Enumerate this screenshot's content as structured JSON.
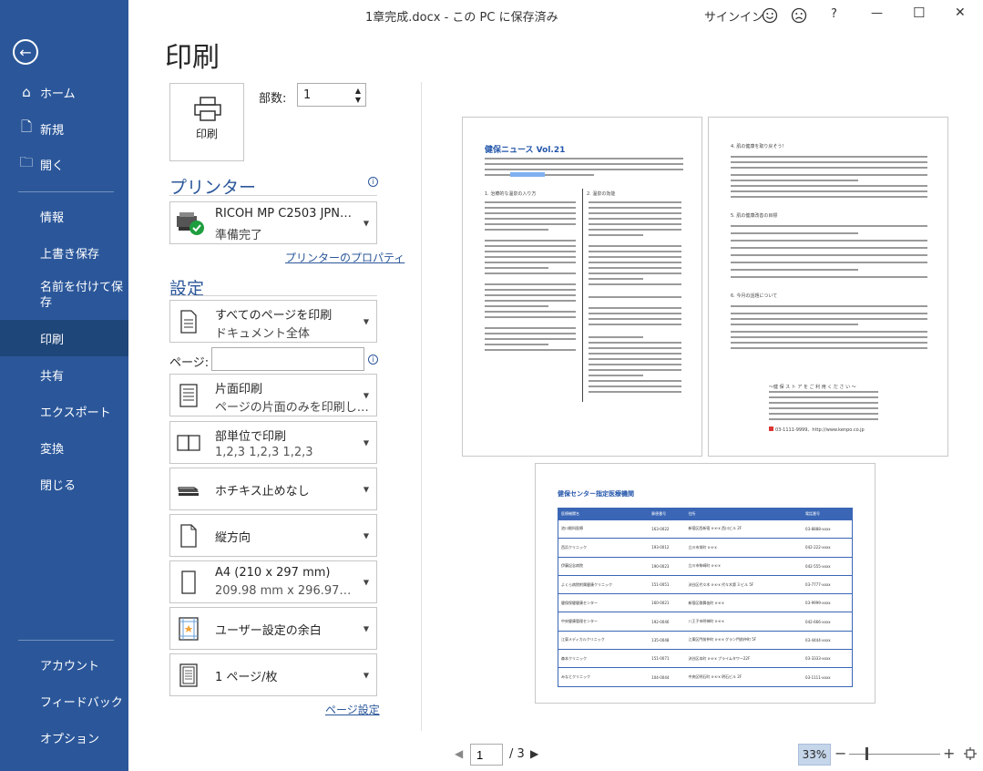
{
  "titlebar": {
    "doc_title": "1章完成.docx - この PC に保存済み",
    "signin": "サインイン",
    "help": "?",
    "minimize": "—",
    "maximize": "☐",
    "close": "✕"
  },
  "sidebar": {
    "back_icon": "←",
    "items": [
      {
        "label": "ホーム",
        "icon": "⌂"
      },
      {
        "label": "新規",
        "icon": "🗋"
      },
      {
        "label": "開く",
        "icon": "🗀"
      },
      {
        "label": "情報"
      },
      {
        "label": "上書き保存"
      },
      {
        "label": "名前を付けて保\n存"
      },
      {
        "label": "印刷"
      },
      {
        "label": "共有"
      },
      {
        "label": "エクスポート"
      },
      {
        "label": "変換"
      },
      {
        "label": "閉じる"
      },
      {
        "label": "アカウント"
      },
      {
        "label": "フィードバック"
      },
      {
        "label": "オプション"
      }
    ],
    "accent": "#2b579a",
    "active_bg": "#1f4679"
  },
  "print": {
    "title": "印刷",
    "button_label": "印刷",
    "copies_label": "部数:",
    "copies_value": "1",
    "printer_heading": "プリンター",
    "printer_name": "RICOH MP C2503 JPN…",
    "printer_status": "準備完了",
    "printer_properties": "プリンターのプロパティ",
    "settings_heading": "設定",
    "pages_label": "ページ:",
    "pages_value": "",
    "page_setup": "ページ設定",
    "settings": [
      {
        "l1": "すべてのページを印刷",
        "l2": "ドキュメント全体"
      },
      {
        "l1": "片面印刷",
        "l2": "ページの片面のみを印刷し…"
      },
      {
        "l1": "部単位で印刷",
        "l2": "1,2,3    1,2,3    1,2,3"
      },
      {
        "l1": "ホチキス止めなし",
        "l2": ""
      },
      {
        "l1": "縦方向",
        "l2": ""
      },
      {
        "l1": "A4 (210 x 297 mm)",
        "l2": "209.98 mm x 296.97…"
      },
      {
        "l1": "ユーザー設定の余白",
        "l2": ""
      },
      {
        "l1": "1 ページ/枚",
        "l2": ""
      }
    ]
  },
  "preview": {
    "page1": {
      "title": "健保ニュース  Vol.21",
      "col1_head": "1. 治療的な温泉の入り方",
      "col2_head": "2. 温泉の効能"
    },
    "page2": {
      "head1": "4. 肌の健康を取り戻そう！",
      "head2": "5. 肌の健康改善の目標",
      "head3": "6. 今月の話題について",
      "closing": "～健 保 ス ト ア を ご 利 用 く だ さ い ～",
      "phone": "03-1111-9999、http://www.kenpo.co.jp"
    },
    "page3": {
      "title": "健保センター指定医療機関",
      "headers": [
        "医療機関名",
        "郵便番号",
        "住所",
        "電話番号"
      ],
      "rows": [
        [
          "池川眼科医療",
          "163-0022",
          "新宿区西新宿 x-x-x 西川ビル 2F",
          "03-8888-xxxx"
        ],
        [
          "西浜クリニック",
          "193-0012",
          "立川市栄町 x-x-x",
          "042-222-xxxx"
        ],
        [
          "伊藤記念病院",
          "190-0023",
          "立川市柴崎町 x-x-x",
          "042-555-xxxx"
        ],
        [
          "よくら病院附属健康クリニック",
          "151-0051",
          "渋谷区代々木 x-x-x 代々木第 3 ビル 5F",
          "03-7777-xxxx"
        ],
        [
          "健保保健健康センター",
          "160-0021",
          "新宿区歌舞伎町 x-x-x",
          "03-9999-xxxx"
        ],
        [
          "中央健康管理センター",
          "192-0046",
          "八王子市明神町 x-x-x",
          "042-666-xxxx"
        ],
        [
          "江東メディカルクリニック",
          "135-0048",
          "江東区門前仲町 x-x-x グラン門前仲町 5F",
          "03-4444-xxxx"
        ],
        [
          "森本クリニック",
          "151-0071",
          "渋谷区本町 x-x-x プライムタワー22F",
          "03-3333-xxxx"
        ],
        [
          "みなとクリニック",
          "104-0044",
          "中央区明石町 x-x-x 明石ビル 2F",
          "03-1111-xxxx"
        ]
      ]
    }
  },
  "bottom": {
    "page_current": "1",
    "page_total": "/ 3",
    "zoom": "33%",
    "zoom_minus": "−",
    "zoom_plus": "+",
    "zoom_level": 0.33
  }
}
